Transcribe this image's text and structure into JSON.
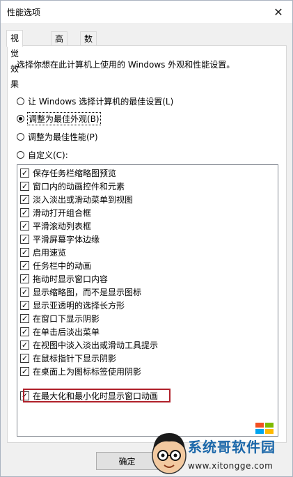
{
  "window": {
    "title": "性能选项",
    "close_icon": "close-icon"
  },
  "tabs": [
    {
      "label": "视觉效果",
      "active": true
    },
    {
      "label": "高级",
      "active": false
    },
    {
      "label": "数据执行保护",
      "active": false
    }
  ],
  "panel": {
    "description": "选择你想在此计算机上使用的 Windows 外观和性能设置。",
    "options": [
      {
        "label": "让 Windows 选择计算机的最佳设置(L)",
        "selected": false
      },
      {
        "label": "调整为最佳外观(B)",
        "selected": true
      },
      {
        "label": "调整为最佳性能(P)",
        "selected": false
      },
      {
        "label": "自定义(C):",
        "selected": false
      }
    ],
    "effects": [
      {
        "label": "保存任务栏缩略图预览",
        "checked": true
      },
      {
        "label": "窗口内的动画控件和元素",
        "checked": true
      },
      {
        "label": "淡入淡出或滑动菜单到视图",
        "checked": true
      },
      {
        "label": "滑动打开组合框",
        "checked": true
      },
      {
        "label": "平滑滚动列表框",
        "checked": true
      },
      {
        "label": "平滑屏幕字体边缘",
        "checked": true
      },
      {
        "label": "启用速览",
        "checked": true
      },
      {
        "label": "任务栏中的动画",
        "checked": true
      },
      {
        "label": "拖动时显示窗口内容",
        "checked": true
      },
      {
        "label": "显示缩略图，而不是显示图标",
        "checked": true
      },
      {
        "label": "显示亚透明的选择长方形",
        "checked": true
      },
      {
        "label": "在窗口下显示阴影",
        "checked": true
      },
      {
        "label": "在单击后淡出菜单",
        "checked": true
      },
      {
        "label": "在视图中淡入淡出或滑动工具提示",
        "checked": true
      },
      {
        "label": "在鼠标指针下显示阴影",
        "checked": true
      },
      {
        "label": "在桌面上为图标标签使用阴影",
        "checked": true
      },
      {
        "label": "在最大化和最小化时显示窗口动画",
        "checked": true
      }
    ],
    "highlighted_index": 16
  },
  "buttons": {
    "ok": "确定"
  },
  "watermark": {
    "site_name": "系统哥软件园",
    "url": "www.xitongge.com",
    "colors": {
      "title": "#1b67a9",
      "highlight": "#b0202a"
    }
  }
}
